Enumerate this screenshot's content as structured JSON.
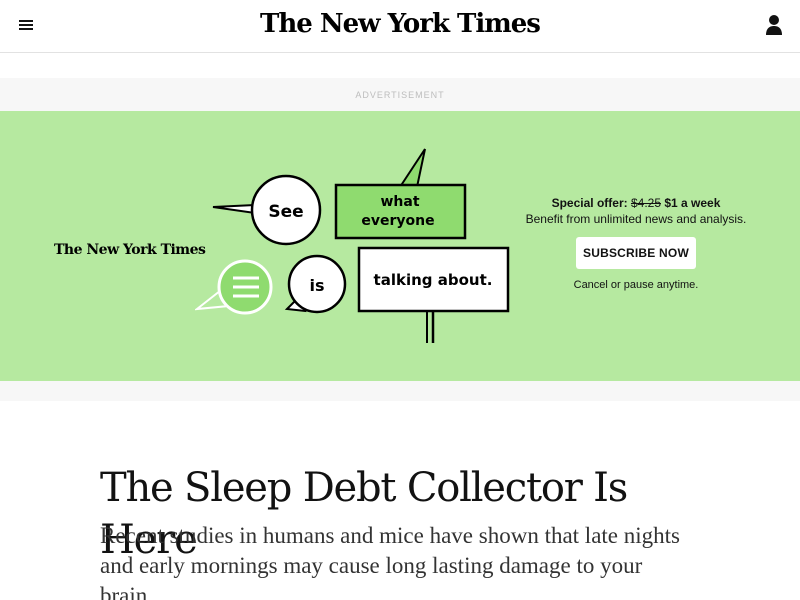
{
  "header": {
    "masthead": "The New York Times",
    "menu_icon": "hamburger-menu-icon",
    "account_icon": "person-icon"
  },
  "ad": {
    "label": "ADVERTISEMENT",
    "logo": "The New York Times",
    "bubbles": [
      "See",
      "what",
      "everyone",
      "is",
      "talking about."
    ],
    "offer_label": "Special offer:",
    "old_price": "$4.25",
    "new_price": "$1 a week",
    "benefit": "Benefit from unlimited news and analysis.",
    "cta": "SUBSCRIBE NOW",
    "cancel_note": "Cancel or pause anytime.",
    "colors": {
      "banner": "#b6e9a0",
      "bubble_green": "#8fdb6f"
    }
  },
  "article": {
    "headline": "The Sleep Debt Collector Is Here",
    "dek": "Recent studies in humans and mice have shown that late nights and early mornings may cause long lasting damage to your brain."
  }
}
